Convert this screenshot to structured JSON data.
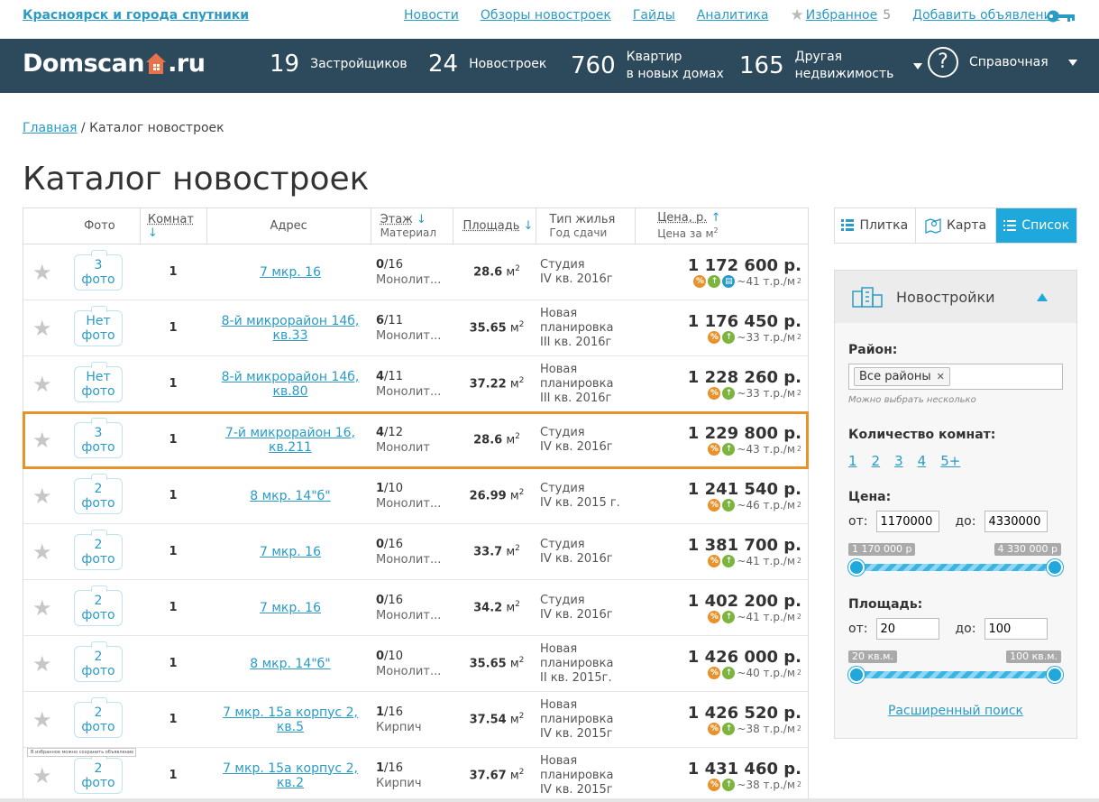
{
  "topbar": {
    "city": "Красноярск и города спутники",
    "links": [
      "Новости",
      "Обзоры новостроек",
      "Гайды",
      "Аналитика"
    ],
    "favorites": {
      "label": "Избранное",
      "count": "5"
    },
    "add_ad": "Добавить объявление"
  },
  "nav": {
    "logo_left": "Domscan",
    "logo_right": ".ru",
    "stats": [
      {
        "num": "19",
        "label": "Застройщиков"
      },
      {
        "num": "24",
        "label": "Новостроек"
      },
      {
        "num": "760",
        "label1": "Квартир",
        "label2": "в новых домах"
      },
      {
        "num": "165",
        "label1": "Другая",
        "label2": "недвижимость"
      }
    ],
    "help": {
      "glyph": "?",
      "label": "Справочная"
    }
  },
  "breadcrumb": {
    "home": "Главная",
    "sep": " / ",
    "current": "Каталог новостроек"
  },
  "page_title": "Каталог новостроек",
  "table": {
    "headers": {
      "photo": "Фото",
      "rooms": "Комнат",
      "address": "Адрес",
      "floor": "Этаж",
      "floor_sub": "Материал",
      "area": "Площадь",
      "type": "Тип жилья",
      "type_sub": "Год сдачи",
      "price": "Цена, р.",
      "price_sub": "Цена за м",
      "price_sub_sup": "2",
      "arrow_down": "↓",
      "arrow_up": "↑"
    },
    "area_unit": "м",
    "area_sup": "2",
    "rows": [
      {
        "photo1": "3",
        "photo2": "фото",
        "rooms": "1",
        "addr": "7 мкр. 16",
        "floor": "0",
        "floors": "/16",
        "material": "Монолит...",
        "area": "28.6",
        "type": "Студия",
        "year": "IV кв. 2016г",
        "price": "1 172 600 р.",
        "ppm": "~41 т.р./м",
        "ppm_sup": "2"
      },
      {
        "photo1": "Нет",
        "photo2": "фото",
        "rooms": "1",
        "addr": "8-й микрорайон 14б, кв.33",
        "floor": "6",
        "floors": "/11",
        "material": "Монолит...",
        "area": "35.65",
        "type": "Новая планировка",
        "year": "III кв. 2016г",
        "price": "1 176 450 р.",
        "ppm": "~33 т.р./м",
        "ppm_sup": "2"
      },
      {
        "photo1": "Нет",
        "photo2": "фото",
        "rooms": "1",
        "addr": "8-й микрорайон 14б, кв.80",
        "floor": "4",
        "floors": "/11",
        "material": "Монолит...",
        "area": "37.22",
        "type": "Новая планировка",
        "year": "III кв. 2016г",
        "price": "1 228 260 р.",
        "ppm": "~33 т.р./м",
        "ppm_sup": "2"
      },
      {
        "photo1": "3",
        "photo2": "фото",
        "rooms": "1",
        "addr": "7-й микрорайон 16, кв.211",
        "floor": "4",
        "floors": "/12",
        "material": "Монолит",
        "area": "28.6",
        "type": "Студия",
        "year": "IV кв. 2016г",
        "price": "1 229 800 р.",
        "ppm": "~43 т.р./м",
        "ppm_sup": "2"
      },
      {
        "photo1": "2",
        "photo2": "фото",
        "rooms": "1",
        "addr": "8 мкр. 14\"б\"",
        "floor": "1",
        "floors": "/10",
        "material": "Монолит...",
        "area": "26.99",
        "type": "Студия",
        "year": "IV кв. 2015 г.",
        "price": "1 241 540 р.",
        "ppm": "~46 т.р./м",
        "ppm_sup": "2"
      },
      {
        "photo1": "2",
        "photo2": "фото",
        "rooms": "1",
        "addr": "7 мкр. 16",
        "floor": "0",
        "floors": "/16",
        "material": "Монолит...",
        "area": "33.7",
        "type": "Студия",
        "year": "IV кв. 2016г",
        "price": "1 381 700 р.",
        "ppm": "~41 т.р./м",
        "ppm_sup": "2"
      },
      {
        "photo1": "2",
        "photo2": "фото",
        "rooms": "1",
        "addr": "7 мкр. 16",
        "floor": "0",
        "floors": "/16",
        "material": "Монолит...",
        "area": "34.2",
        "type": "Студия",
        "year": "IV кв. 2016г",
        "price": "1 402 200 р.",
        "ppm": "~41 т.р./м",
        "ppm_sup": "2"
      },
      {
        "photo1": "2",
        "photo2": "фото",
        "rooms": "1",
        "addr": "8 мкр. 14\"б\"",
        "floor": "0",
        "floors": "/10",
        "material": "Монолит...",
        "area": "35.65",
        "type": "Новая планировка",
        "year": "II кв. 2015г.",
        "price": "1 426 000 р.",
        "ppm": "~40 т.р./м",
        "ppm_sup": "2"
      },
      {
        "photo1": "2",
        "photo2": "фото",
        "rooms": "1",
        "addr": "7 мкр. 15а корпус 2, кв.5",
        "floor": "1",
        "floors": "/16",
        "material": "Кирпич",
        "area": "37.54",
        "type": "Новая планировка",
        "year": "IV кв. 2015г",
        "price": "1 426 520 р.",
        "ppm": "~38 т.р./м",
        "ppm_sup": "2"
      },
      {
        "photo1": "2",
        "photo2": "фото",
        "rooms": "1",
        "addr": "7 мкр. 15а корпус 2, кв.2",
        "floor": "1",
        "floors": "/16",
        "material": "Кирпич",
        "area": "37.67",
        "type": "Новая планировка",
        "year": "IV кв. 2015г",
        "price": "1 431 460 р.",
        "ppm": "~38 т.р./м",
        "ppm_sup": "2"
      }
    ],
    "tooltip": "В избранное можно сохранить объявление"
  },
  "views": {
    "tile": "Плитка",
    "map": "Карта",
    "list": "Список"
  },
  "filters": {
    "title": "Новостройки",
    "district_label": "Район:",
    "district_tag": "Все районы",
    "tag_remove": "✕",
    "district_hint": "Можно выбрать несколько",
    "rooms_label": "Количество комнат:",
    "rooms": [
      "1",
      "2",
      "3",
      "4",
      "5+"
    ],
    "price_label": "Цена:",
    "from": "от:",
    "to": "до:",
    "price_from": "1170000",
    "price_to": "4330000",
    "price_min_chip": "1 170 000 р",
    "price_max_chip": "4 330 000 р",
    "area_label": "Площадь:",
    "area_from": "20",
    "area_to": "100",
    "area_min_chip": "20 кв.м.",
    "area_max_chip": "100 кв.м.",
    "advanced": "Расширенный поиск"
  },
  "colors": {
    "nav_bg": "#2d4a5c",
    "accent": "#1fa8dc",
    "link": "#2a9bc5",
    "logo_house": "#e8734a",
    "highlight": "#e8922b"
  }
}
